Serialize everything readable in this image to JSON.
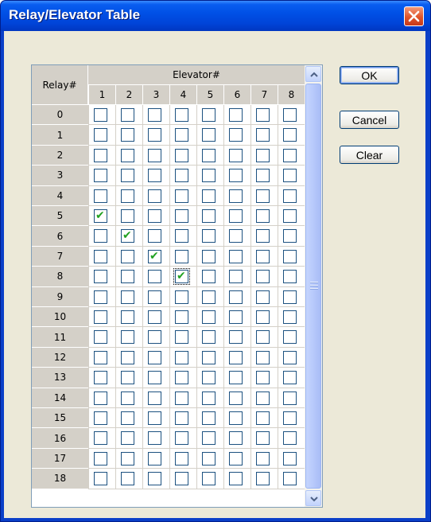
{
  "window": {
    "title": "Relay/Elevator Table"
  },
  "grid": {
    "corner_label": "Relay#",
    "group_header": "Elevator#",
    "columns": [
      "1",
      "2",
      "3",
      "4",
      "5",
      "6",
      "7",
      "8"
    ],
    "rows": [
      {
        "label": "0",
        "checked": []
      },
      {
        "label": "1",
        "checked": []
      },
      {
        "label": "2",
        "checked": []
      },
      {
        "label": "3",
        "checked": []
      },
      {
        "label": "4",
        "checked": []
      },
      {
        "label": "5",
        "checked": [
          1
        ]
      },
      {
        "label": "6",
        "checked": [
          2
        ]
      },
      {
        "label": "7",
        "checked": [
          3
        ]
      },
      {
        "label": "8",
        "checked": [
          4
        ]
      },
      {
        "label": "9",
        "checked": []
      },
      {
        "label": "10",
        "checked": []
      },
      {
        "label": "11",
        "checked": []
      },
      {
        "label": "12",
        "checked": []
      },
      {
        "label": "13",
        "checked": []
      },
      {
        "label": "14",
        "checked": []
      },
      {
        "label": "15",
        "checked": []
      },
      {
        "label": "16",
        "checked": []
      },
      {
        "label": "17",
        "checked": []
      },
      {
        "label": "18",
        "checked": []
      }
    ],
    "focused_cell": {
      "row": "8",
      "column": "4"
    }
  },
  "buttons": {
    "ok": "OK",
    "cancel": "Cancel",
    "clear": "Clear"
  },
  "icons": {
    "close": "close-icon",
    "check": "checkmark-icon",
    "scroll_up": "scroll-up-icon",
    "scroll_down": "scroll-down-icon"
  },
  "colors": {
    "titlebar": "#0054e3",
    "close_button": "#e0542a",
    "checkmark": "#21a121",
    "checkbox_border": "#1c5180",
    "dialog_bg": "#ece9d8",
    "header_bg": "#d4d0c8"
  }
}
